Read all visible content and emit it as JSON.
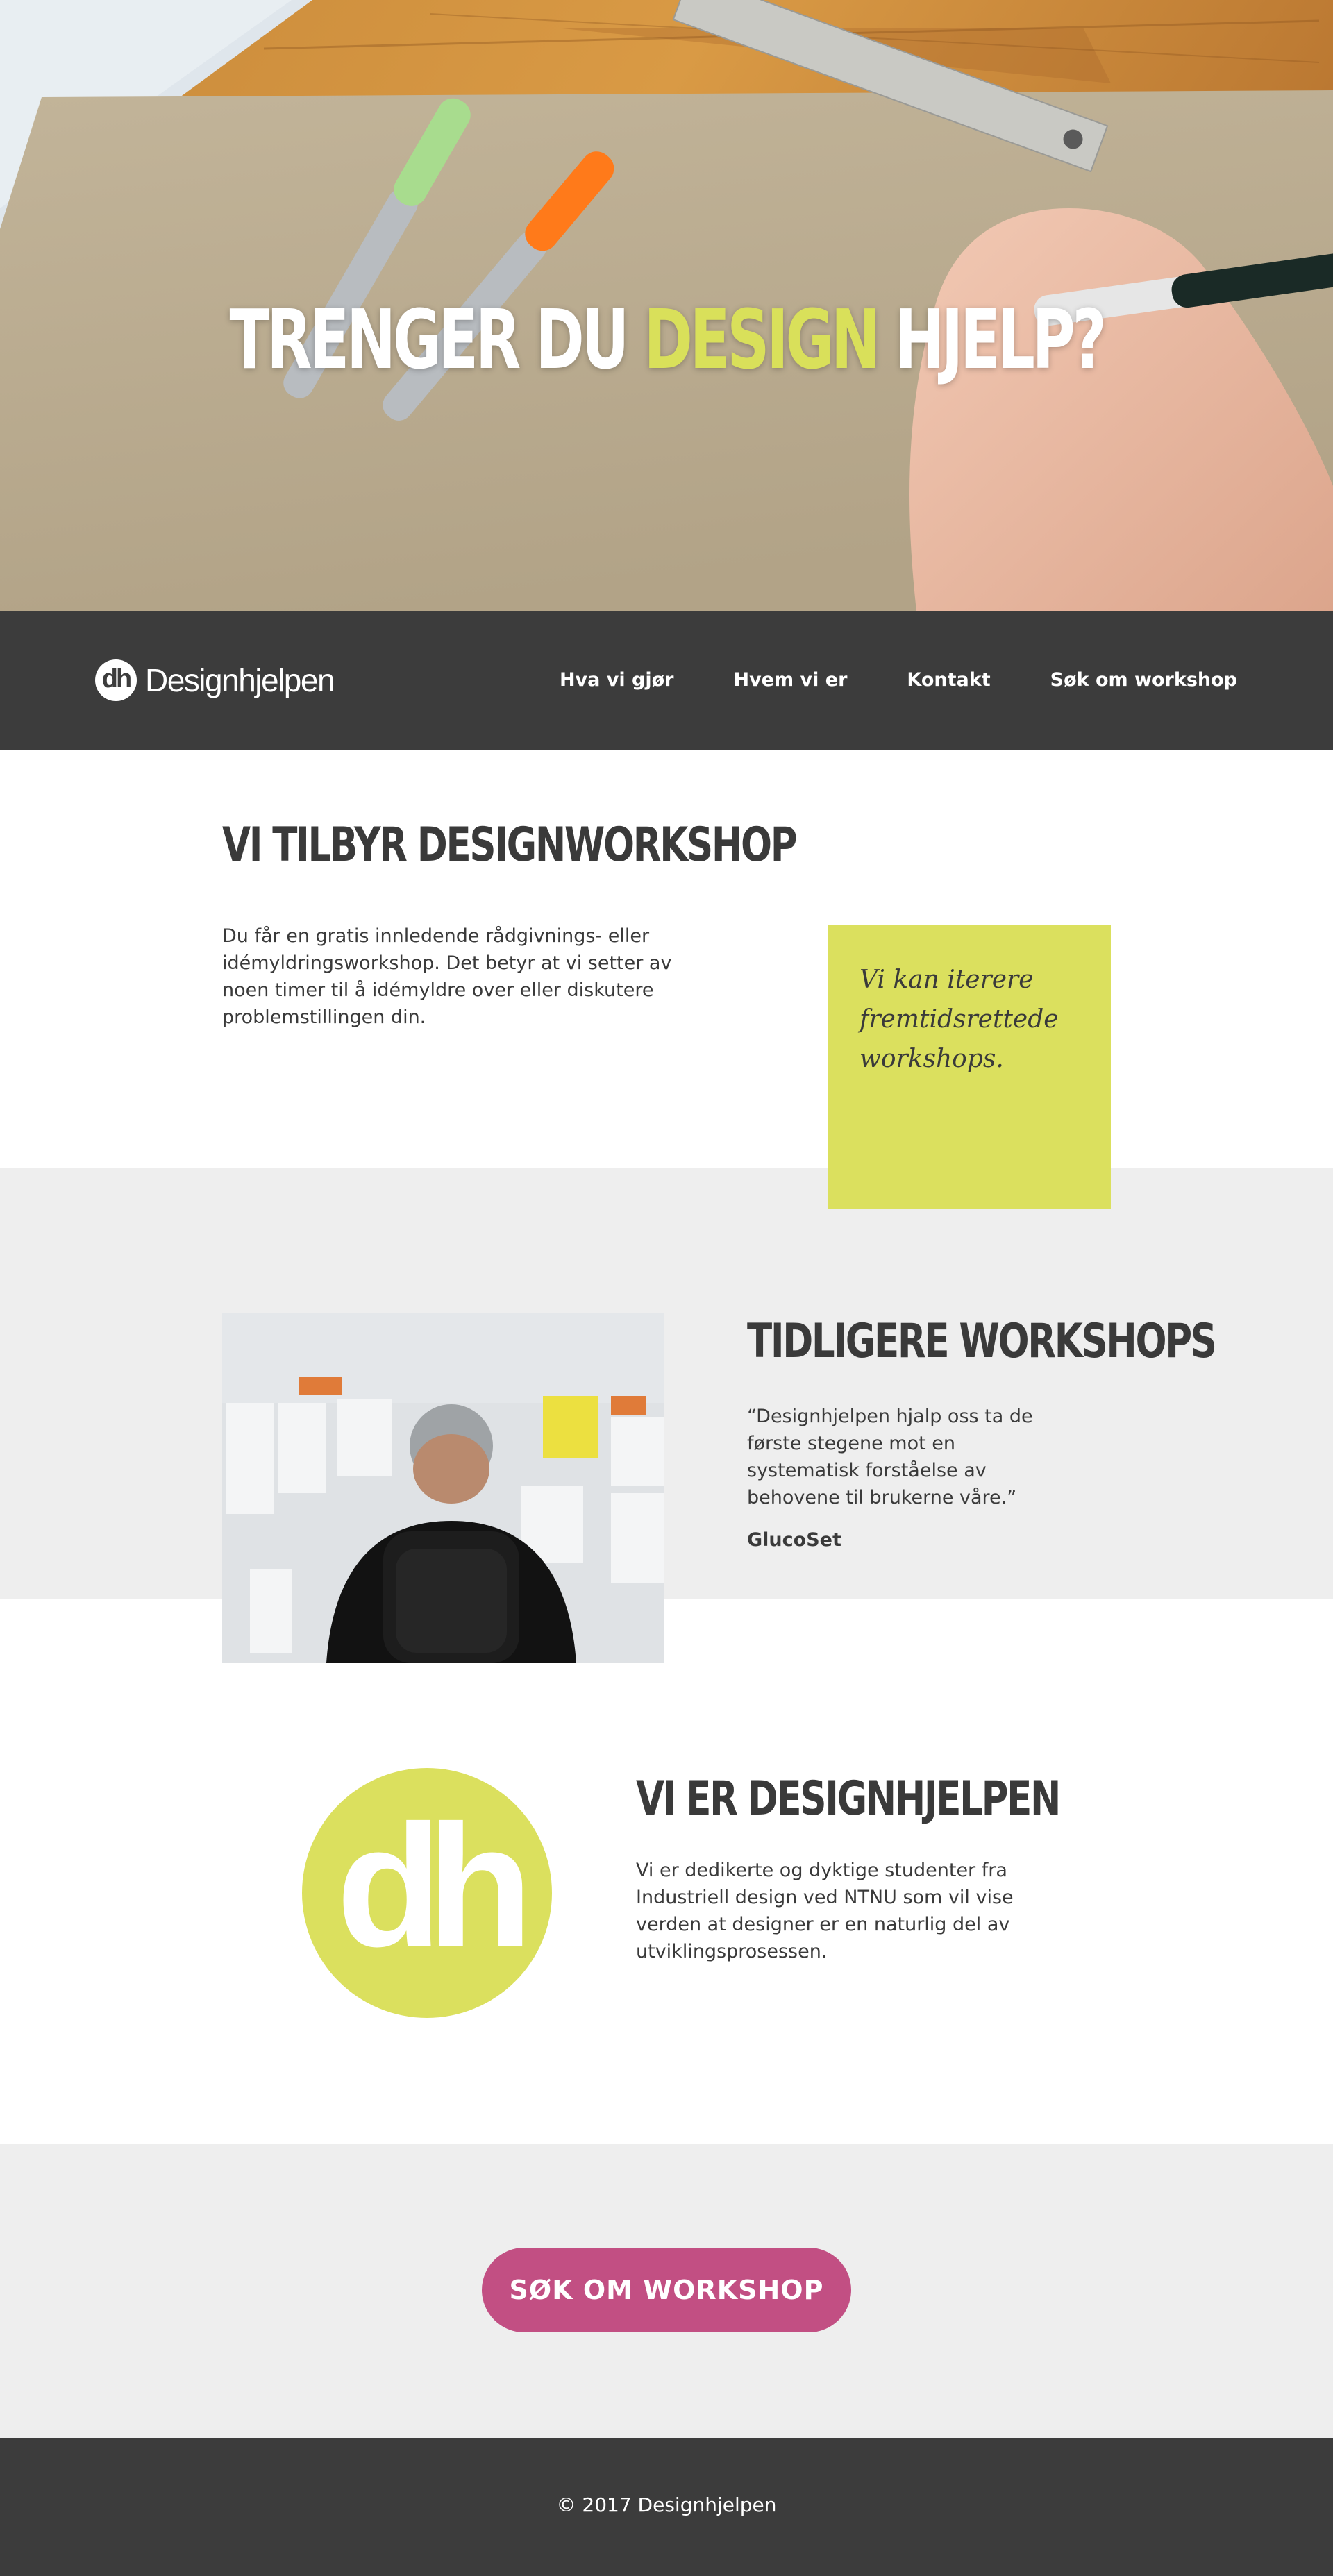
{
  "hero": {
    "title_part1": "TRENGER DU ",
    "title_accent": "DESIGN",
    "title_part2": " HJELP?"
  },
  "navbar": {
    "logo_mark": "dh",
    "logo_text": "Designhjelpen",
    "items": [
      {
        "label": "Hva vi gjør"
      },
      {
        "label": "Hvem vi er"
      },
      {
        "label": "Kontakt"
      },
      {
        "label": "Søk om workshop"
      }
    ]
  },
  "offer": {
    "title": "VI TILBYR DESIGNWORKSHOP",
    "text": "Du får en gratis innledende rådgivnings- eller idémyldringsworkshop. Det betyr at vi setter av noen timer til å idémyldre over eller diskutere problemstillingen din.",
    "sticky_note": "Vi kan iterere fremtidsrettede workshops."
  },
  "previous": {
    "title": "TIDLIGERE WORKSHOPS",
    "quote": "“Designhjelpen hjalp oss ta de første stegene mot en systematisk forståelse av behovene til brukerne våre.”",
    "author": "GlucoSet"
  },
  "about": {
    "logo_mark": "dh",
    "title": "VI ER DESIGNHJELPEN",
    "text": "Vi er dedikerte og dyktige studenter fra Industriell design ved NTNU som vil vise verden at designer er en naturlig del av utviklingsprosessen."
  },
  "cta": {
    "label": "SØK OM WORKSHOP"
  },
  "footer": {
    "copyright": "© 2017 Designhjelpen"
  },
  "colors": {
    "accent": "#d9e05a",
    "dark": "#3c3c3c",
    "cta": "#c24f83",
    "band": "#eeeeee"
  }
}
